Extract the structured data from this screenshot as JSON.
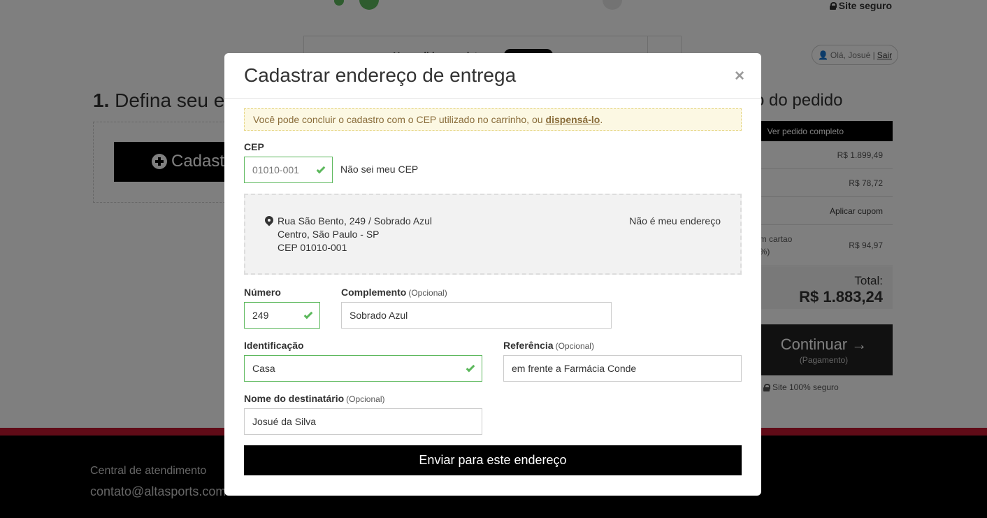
{
  "header": {
    "secure_label": "Site seguro",
    "greeting": "Olá, Josué |",
    "logout": "Sair"
  },
  "order_bar": {
    "text": "Ver pedido completo"
  },
  "step": {
    "number": "1.",
    "title": "Defina seu e",
    "button": "Cadast"
  },
  "summary": {
    "title": "o do pedido",
    "head": "Ver pedido completo",
    "subtotal": "R$ 1.899,49",
    "shipping": "R$ 78,72",
    "coupon": "Aplicar cupom",
    "discount_label_1": "om cartao",
    "discount_label_2": "5%)",
    "discount": "R$ 94,97",
    "total_label": "Total:",
    "total_value": "R$ 1.883,24",
    "continue_label": "Continuar →",
    "continue_sub": "(Pagamento)",
    "secure_label": "Site 100% seguro"
  },
  "footer": {
    "support_label": "Central de atendimento",
    "support_email": "contato@altasports.com"
  },
  "modal": {
    "title": "Cadastrar endereço de entrega",
    "close": "×",
    "alert_text": "Você pode concluir o cadastro com o CEP utilizado no carrinho, ou",
    "alert_link": "dispensá-lo",
    "alert_end": ".",
    "cep_label": "CEP",
    "cep_value": "01010-001",
    "cep_unknown": "Não sei meu CEP",
    "address": {
      "line1": "Rua São Bento, 249 / Sobrado Azul",
      "line2": "Centro, São Paulo - SP",
      "line3": "CEP 01010-001",
      "not_mine": "Não é meu endereço"
    },
    "numero_label": "Número",
    "numero_value": "249",
    "complemento_label": "Complemento",
    "complemento_opt": "(Opcional)",
    "complemento_value": "Sobrado Azul",
    "identificacao_label": "Identificação",
    "identificacao_value": "Casa",
    "referencia_label": "Referência",
    "referencia_opt": "(Opcional)",
    "referencia_value": "em frente a Farmácia Conde",
    "destinatario_label": "Nome do destinatário",
    "destinatario_opt": "(Opcional)",
    "destinatario_value": "Josué da Silva",
    "submit": "Enviar para este endereço"
  },
  "colors": {
    "accent_black": "#000000",
    "success_green": "#5cb85c",
    "alert_bg": "#fcf8e3",
    "footer_red": "#c0162e"
  }
}
